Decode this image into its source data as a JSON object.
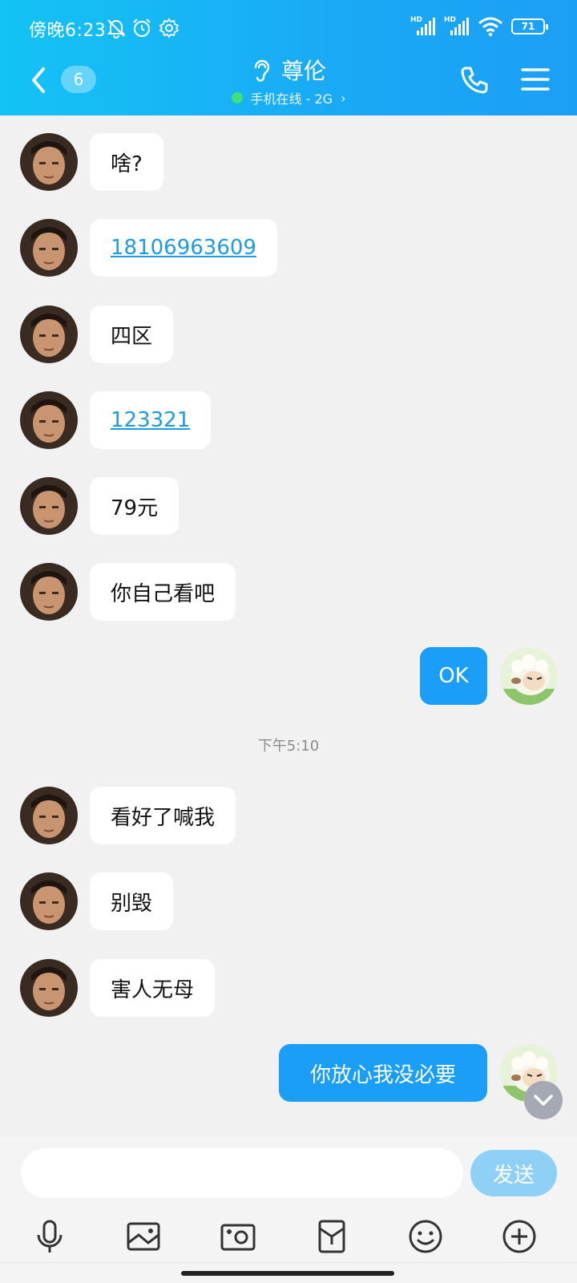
{
  "status_bar": {
    "time": "傍晚6:23",
    "battery": "71"
  },
  "header": {
    "unread_count": "6",
    "title": "尊伦",
    "subtitle": "手机在线 - 2G",
    "subtitle_chevron": "›"
  },
  "messages": [
    {
      "side": "left",
      "text": "啥?",
      "type": "text"
    },
    {
      "side": "left",
      "text": "18106963609",
      "type": "link"
    },
    {
      "side": "left",
      "text": "四区",
      "type": "text"
    },
    {
      "side": "left",
      "text": "123321",
      "type": "link"
    },
    {
      "side": "left",
      "text": "79元",
      "type": "text"
    },
    {
      "side": "left",
      "text": "你自己看吧",
      "type": "text"
    },
    {
      "side": "right",
      "text": "OK",
      "type": "text"
    },
    {
      "side": "left",
      "text": "看好了喊我",
      "type": "text"
    },
    {
      "side": "left",
      "text": "别毁",
      "type": "text"
    },
    {
      "side": "left",
      "text": "害人无母",
      "type": "text"
    },
    {
      "side": "right",
      "text": "你放心我没必要",
      "type": "text"
    }
  ],
  "time_divider": "下午5:10",
  "input": {
    "placeholder": "",
    "send_label": "发送"
  },
  "toolbar_icons": [
    "microphone-icon",
    "image-icon",
    "camera-icon",
    "red-packet-icon",
    "emoji-icon",
    "plus-icon"
  ],
  "colors": {
    "header_start": "#13c3f5",
    "header_end": "#1b9ff5",
    "my_bubble": "#1a9ef7",
    "link": "#1e9be0",
    "send_disabled": "#8fd0f6",
    "online": "#3ee07a"
  }
}
